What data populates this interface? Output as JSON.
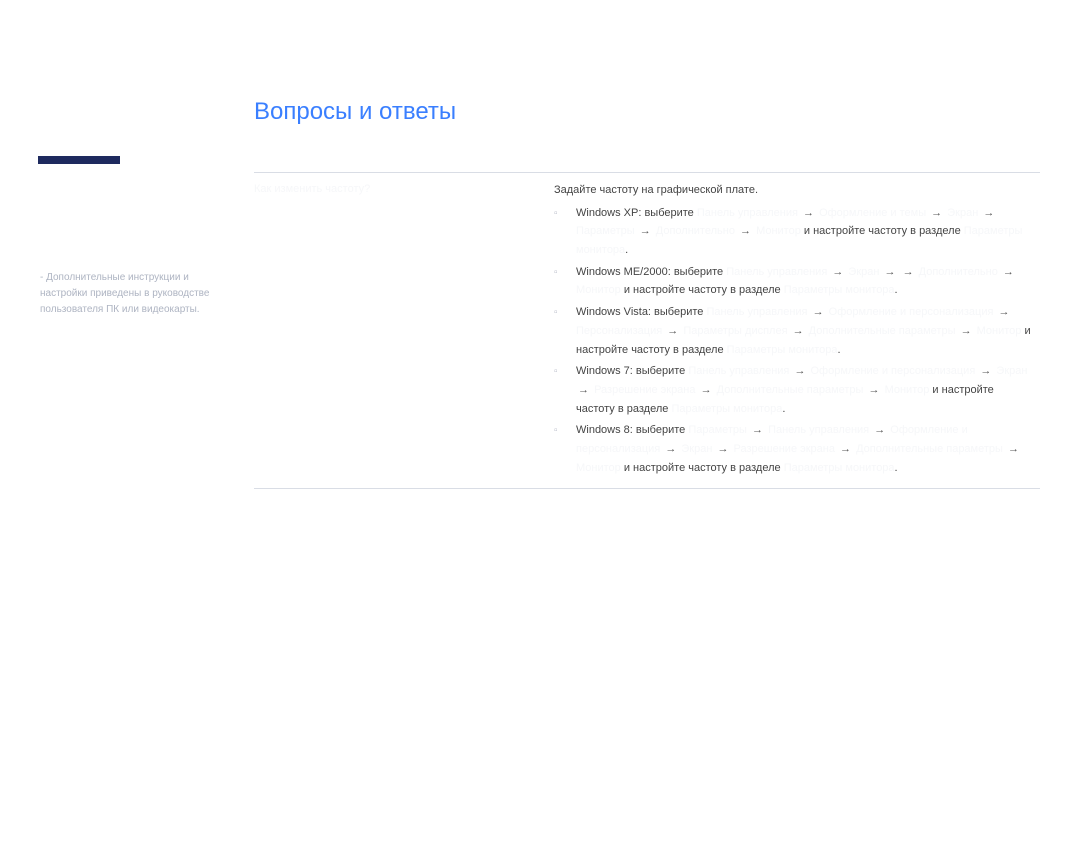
{
  "accent_color": "#1e2a5e",
  "heading_color": "#3a7fff",
  "heading": "Вопросы и ответы",
  "sidebar_note": "Дополнительные инструкции и настройки приведены в руководстве пользователя ПК или видеокарты.",
  "question": "Как изменить частоту?",
  "answer_lead": "Задайте частоту на графической плате.",
  "os_items": [
    {
      "prefix": "Windows XP: выберите",
      "parts": [
        "Панель управления",
        "Оформление и темы",
        "Экран",
        "Параметры",
        "Дополнительно",
        "Монитор",
        "и настройте частоту в разделе",
        "Параметры монитора"
      ]
    },
    {
      "prefix": "Windows ME/2000: выберите",
      "parts": [
        "Панель управления",
        "Экран",
        "Параметры",
        "Дополнительно",
        "Монитор",
        "и настройте частоту в разделе",
        "Параметры монитора"
      ]
    },
    {
      "prefix": "Windows Vista: выберите",
      "parts": [
        "Панель управления",
        "Оформление и персонализация",
        "Персонализация",
        "Параметры дисплея",
        "Дополнительные параметры",
        "Монитор",
        "и настройте частоту в разделе",
        "Параметры монитора"
      ]
    },
    {
      "prefix": "Windows 7: выберите",
      "parts": [
        "Панель управления",
        "Оформление и персонализация",
        "Экран",
        "Разрешение экрана",
        "Дополнительные параметры",
        "Монитор",
        "и настройте частоту в разделе",
        "Параметры монитора"
      ]
    },
    {
      "prefix": "Windows 8: выберите",
      "parts": [
        "Параметры",
        "Панель управления",
        "Оформление и персонализация",
        "Экран",
        "Разрешение экрана",
        "Дополнительные параметры",
        "Монитор",
        "и настройте частоту в разделе",
        "Параметры монитора"
      ]
    }
  ],
  "arrow_glyph": "→",
  "bullet_glyph": "▫"
}
